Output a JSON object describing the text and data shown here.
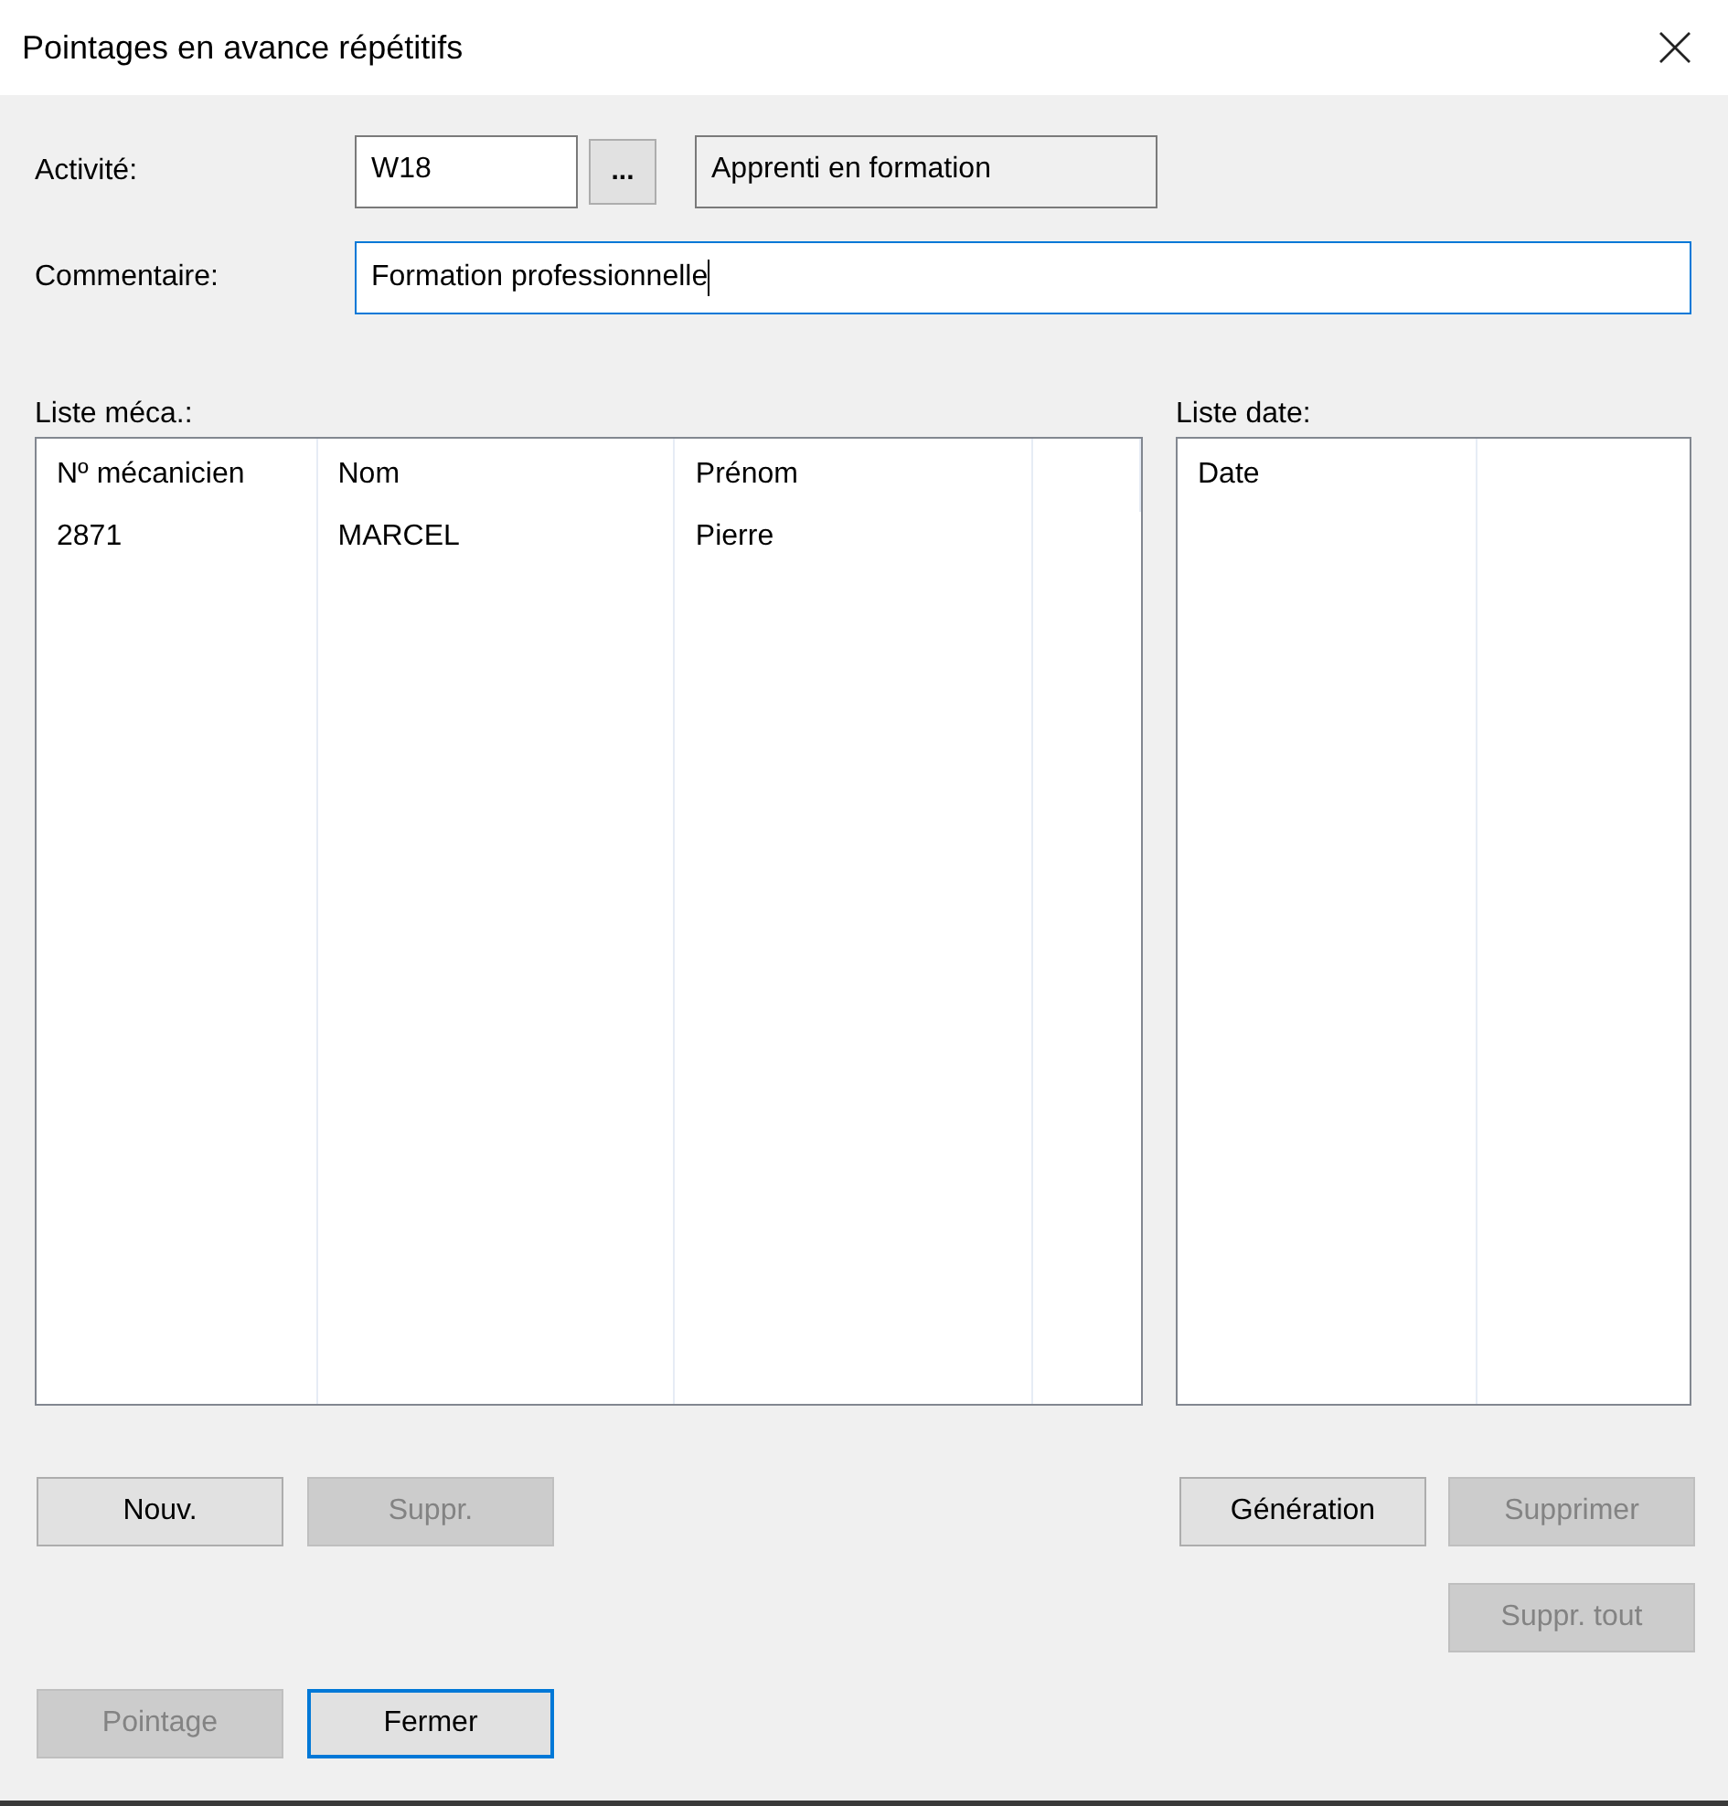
{
  "window": {
    "title": "Pointages en avance répétitifs"
  },
  "activity": {
    "label": "Activité:",
    "code": "W18",
    "browse": "...",
    "description": "Apprenti en formation"
  },
  "comment": {
    "label": "Commentaire:",
    "value": "Formation professionnelle",
    "focused": true
  },
  "mechanic_list": {
    "label": "Liste méca.:",
    "columns": [
      "Nº mécanicien",
      "Nom",
      "Prénom"
    ],
    "rows": [
      [
        "2871",
        "MARCEL",
        "Pierre"
      ]
    ]
  },
  "date_list": {
    "label": "Liste date:",
    "columns": [
      "Date"
    ]
  },
  "mechanic_buttons": [
    {
      "label": "Nouv.",
      "disabled": false,
      "default": false
    },
    {
      "label": "Suppr.",
      "disabled": true,
      "default": false
    }
  ],
  "date_buttons": [
    {
      "label": "Génération",
      "disabled": false,
      "default": false
    },
    {
      "label": "Supprimer",
      "disabled": true,
      "default": false
    },
    {
      "label": "Suppr. tout",
      "disabled": true,
      "default": false
    }
  ],
  "bottom_buttons": [
    {
      "label": "Pointage",
      "disabled": true,
      "default": false
    },
    {
      "label": "Fermer",
      "disabled": false,
      "default": true
    }
  ]
}
